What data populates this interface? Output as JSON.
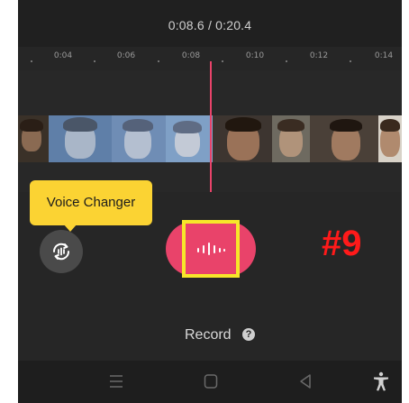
{
  "header": {
    "time_readout": "0:08.6 / 0:20.4"
  },
  "ruler": {
    "ticks": [
      "0:04",
      "0:06",
      "0:08",
      "0:10",
      "0:12",
      "0:14"
    ]
  },
  "tooltip": {
    "text": "Voice Changer"
  },
  "record": {
    "label": "Record",
    "help_icon": "?"
  },
  "annotation": {
    "step_label": "#9"
  },
  "colors": {
    "accent": "#e9436a",
    "tooltip_bg": "#fbd333",
    "highlight_border": "#f7e62a",
    "step_label": "#ff1a1a",
    "background": "#272727"
  },
  "icons": {
    "voice_changer": "voice-changer-icon",
    "record": "waveform-icon",
    "nav_menu": "menu-icon",
    "nav_home": "home-icon",
    "nav_back": "back-icon",
    "nav_accessibility": "accessibility-icon"
  }
}
